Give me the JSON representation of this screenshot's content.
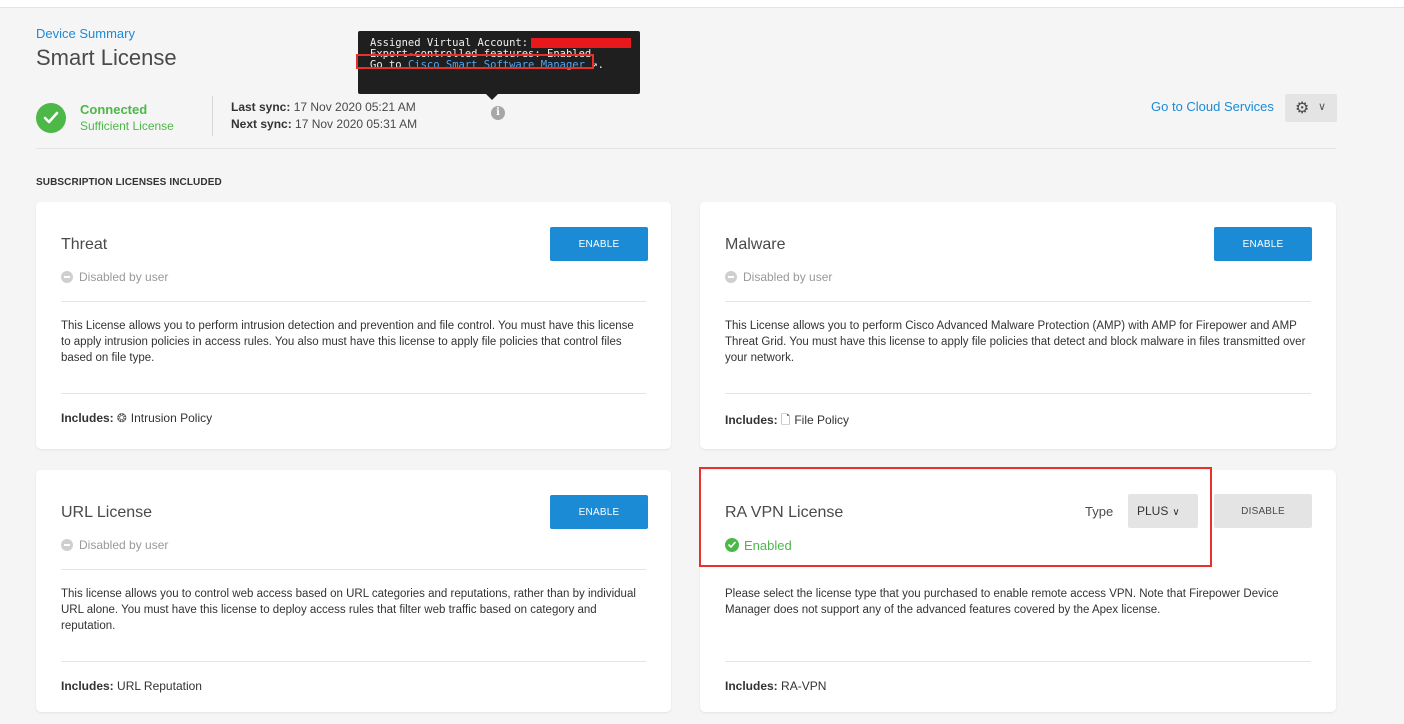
{
  "breadcrumb": "Device Summary",
  "page_title": "Smart License",
  "status": {
    "connected": "Connected",
    "license": "Sufficient License",
    "last_sync_label": "Last sync:",
    "last_sync_value": " 17 Nov 2020 05:21 AM",
    "next_sync_label": "Next sync:",
    "next_sync_value": " 17 Nov 2020 05:31 AM"
  },
  "tooltip": {
    "assigned_label": "Assigned Virtual Account:",
    "export_text": "Export-controlled features: Enabled",
    "goto_prefix": "Go to ",
    "goto_link": "Cisco Smart Software Manager",
    "goto_suffix": "."
  },
  "header_actions": {
    "cloud_link": "Go to Cloud Services",
    "gear_icon": "gear-icon",
    "chevron": "chevron-down-icon"
  },
  "section_label": "SUBSCRIPTION LICENSES INCLUDED",
  "cards": [
    {
      "title": "Threat",
      "state": "Disabled by user",
      "button": "ENABLE",
      "description": "This License allows you to perform intrusion detection and prevention and file control. You must have this license to apply intrusion policies in access rules. You also must have this license to apply file policies that control files based on file type.",
      "includes_label": "Includes:",
      "includes_value": "Intrusion Policy",
      "includes_icon": "intrusion-policy-icon"
    },
    {
      "title": "Malware",
      "state": "Disabled by user",
      "button": "ENABLE",
      "description": "This License allows you to perform Cisco Advanced Malware Protection (AMP) with AMP for Firepower and AMP Threat Grid. You must have this license to apply file policies that detect and block malware in files transmitted over your network.",
      "includes_label": "Includes:",
      "includes_value": "File Policy",
      "includes_icon": "file-policy-icon"
    },
    {
      "title": "URL License",
      "state": "Disabled by user",
      "button": "ENABLE",
      "description": "This license allows you to control web access based on URL categories and reputations, rather than by individual URL alone. You must have this license to deploy access rules that filter web traffic based on category and reputation.",
      "includes_label": "Includes:",
      "includes_value": " URL Reputation"
    },
    {
      "title": "RA VPN License",
      "state": "Enabled",
      "type_label": "Type",
      "type_value": "PLUS",
      "button": "DISABLE",
      "description": "Please select the license type that you purchased to enable remote access VPN. Note that Firepower Device Manager does not support any of the advanced features covered by the Apex license.",
      "includes_label": "Includes:",
      "includes_value": " RA-VPN"
    }
  ],
  "colors": {
    "accent": "#1b8bd6",
    "success": "#4cb848",
    "highlight": "#e8312b",
    "redaction": "#e8181b"
  }
}
